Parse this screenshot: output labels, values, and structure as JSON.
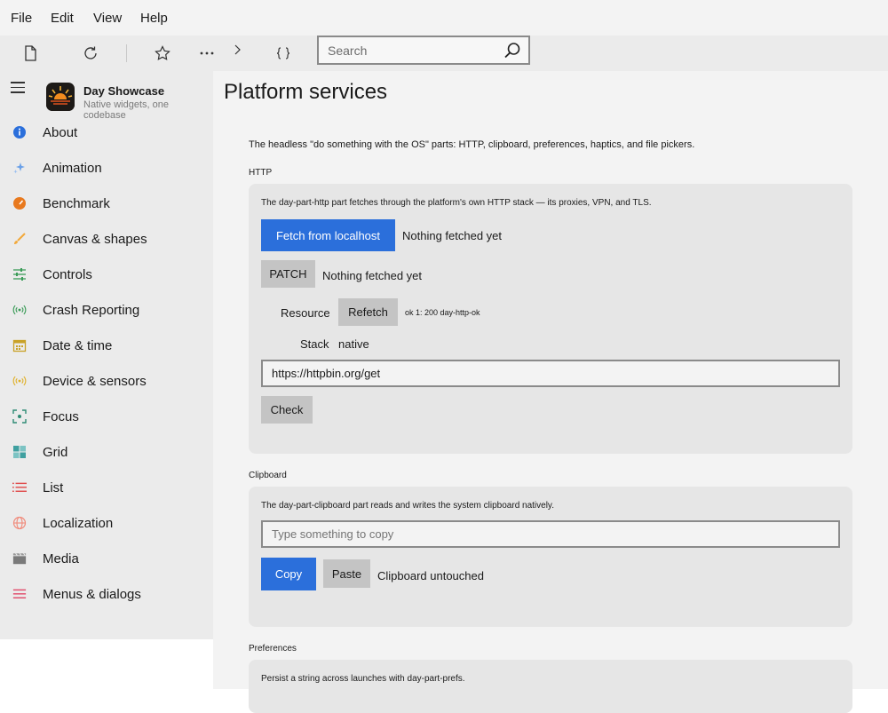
{
  "menubar": {
    "items": [
      "File",
      "Edit",
      "View",
      "Help"
    ]
  },
  "toolbar": {
    "icons": [
      "new-file-icon",
      "refresh-icon",
      "star-icon",
      "more-icon",
      "chevron-right-icon",
      "braces-icon"
    ],
    "search_placeholder": "Search"
  },
  "app": {
    "name": "Day Showcase",
    "subtitle": "Native widgets, one codebase"
  },
  "sidebar": {
    "items": [
      {
        "label": "About",
        "icon": "info-icon",
        "color": "#2b6fdb"
      },
      {
        "label": "Animation",
        "icon": "sparkle-icon",
        "color": "#6aa0e8"
      },
      {
        "label": "Benchmark",
        "icon": "gauge-icon",
        "color": "#e8791e"
      },
      {
        "label": "Canvas & shapes",
        "icon": "brush-icon",
        "color": "#f2a93b"
      },
      {
        "label": "Controls",
        "icon": "sliders-icon",
        "color": "#3a9b57"
      },
      {
        "label": "Crash Reporting",
        "icon": "broadcast-icon",
        "color": "#3a9b57"
      },
      {
        "label": "Date & time",
        "icon": "calendar-icon",
        "color": "#c9a227"
      },
      {
        "label": "Device & sensors",
        "icon": "sensor-icon",
        "color": "#e0b12b"
      },
      {
        "label": "Focus",
        "icon": "focus-icon",
        "color": "#2e8b74"
      },
      {
        "label": "Grid",
        "icon": "grid-icon",
        "color": "#3fa0a0"
      },
      {
        "label": "List",
        "icon": "list-icon",
        "color": "#e04b4b"
      },
      {
        "label": "Localization",
        "icon": "globe-icon",
        "color": "#f08a7a"
      },
      {
        "label": "Media",
        "icon": "clapper-icon",
        "color": "#7a7a7a"
      },
      {
        "label": "Menus & dialogs",
        "icon": "menu-icon",
        "color": "#e04b6b"
      }
    ]
  },
  "page": {
    "title": "Platform services",
    "intro": "The headless \"do something with the OS\" parts: HTTP, clipboard, preferences, haptics, and file pickers."
  },
  "http": {
    "section_label": "HTTP",
    "description": "The day-part-http part fetches through the platform's own HTTP stack — its proxies, VPN, and TLS.",
    "fetch_button": "Fetch from localhost",
    "fetch_status": "Nothing fetched yet",
    "patch_button": "PATCH",
    "patch_status": "Nothing fetched yet",
    "resource_label": "Resource",
    "refetch_button": "Refetch",
    "resource_status": "ok 1: 200 day-http-ok",
    "stack_label": "Stack",
    "stack_value": "native",
    "url_value": "https://httpbin.org/get",
    "check_button": "Check"
  },
  "clipboard": {
    "section_label": "Clipboard",
    "description": "The day-part-clipboard part reads and writes the system clipboard natively.",
    "input_placeholder": "Type something to copy",
    "copy_button": "Copy",
    "paste_button": "Paste",
    "status": "Clipboard untouched"
  },
  "preferences": {
    "section_label": "Preferences",
    "description": "Persist a string across launches with day-part-prefs."
  },
  "colors": {
    "accent": "#2b6fdb",
    "sidebar_bg": "#ebebeb",
    "content_bg": "#f3f3f3",
    "card_bg": "#e6e6e6"
  }
}
